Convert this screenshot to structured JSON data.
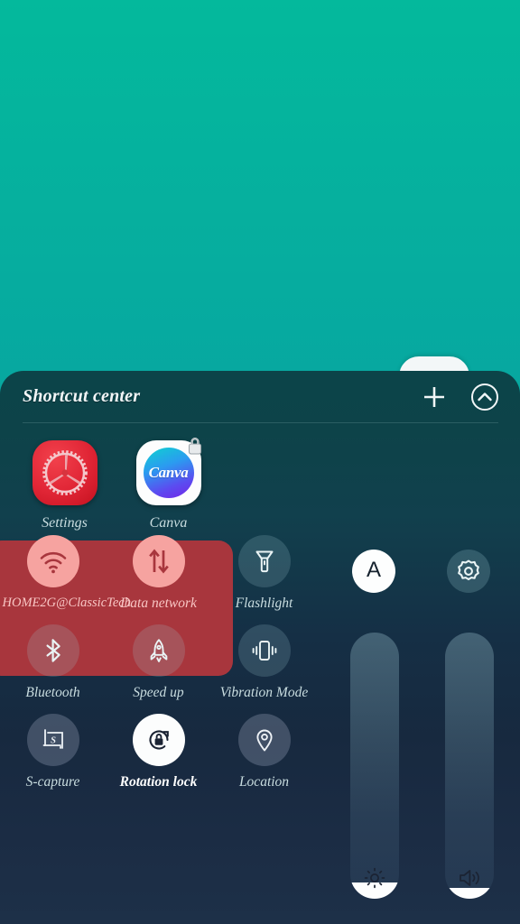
{
  "wallpaper": {
    "gradient_top": "#04b99c",
    "gradient_bottom": "#0b8fa6"
  },
  "panel": {
    "title": "Shortcut center",
    "background_top": "#0c4449",
    "background_bottom": "#1d3048",
    "header_actions": [
      {
        "name": "add-shortcut",
        "icon": "plus-icon",
        "label": "Add"
      },
      {
        "name": "collapse-panel",
        "icon": "chevron-up-circle-icon",
        "label": "Collapse"
      }
    ]
  },
  "app_shortcuts": [
    {
      "label": "Settings",
      "icon": "settings-gear-app-icon",
      "icon_color": "#e02535",
      "locked": false
    },
    {
      "label": "Canva",
      "icon": "canva-app-icon",
      "wordmark": "Canva",
      "icon_color": "#7324e8",
      "locked": true,
      "badge_icon": "lock-icon"
    }
  ],
  "highlight_group": {
    "color": "#a8363d",
    "contains": [
      "HOME2G@ClassicTech",
      "Data network"
    ]
  },
  "toggles": [
    {
      "label": "HOME2G@ClassicTech",
      "icon": "wifi-icon",
      "state": "on",
      "style": "on-red"
    },
    {
      "label": "Data network",
      "icon": "data-transfer-arrows-icon",
      "state": "on",
      "style": "on-red"
    },
    {
      "label": "Flashlight",
      "icon": "flashlight-icon",
      "state": "off",
      "style": "default"
    },
    {
      "label": "Bluetooth",
      "icon": "bluetooth-icon",
      "state": "off",
      "style": "default"
    },
    {
      "label": "Speed up",
      "icon": "rocket-icon",
      "state": "off",
      "style": "default"
    },
    {
      "label": "Vibration Mode",
      "icon": "vibration-icon",
      "state": "off",
      "style": "default"
    },
    {
      "label": "S-capture",
      "icon": "screen-capture-icon",
      "state": "off",
      "style": "grey"
    },
    {
      "label": "Rotation lock",
      "icon": "rotation-lock-icon",
      "state": "on",
      "style": "on-white"
    },
    {
      "label": "Location",
      "icon": "location-pin-icon",
      "state": "off",
      "style": "grey"
    }
  ],
  "right_controls": {
    "auto_brightness": {
      "name": "auto-brightness-toggle",
      "letter": "A",
      "state": "on"
    },
    "quick_settings": {
      "name": "quick-settings-button",
      "icon": "gear-icon",
      "state": "off"
    },
    "sliders": [
      {
        "name": "brightness-slider",
        "icon": "brightness-sun-icon",
        "value_percent": 6,
        "min": 0,
        "max": 100
      },
      {
        "name": "volume-slider",
        "icon": "volume-speaker-icon",
        "value_percent": 4,
        "min": 0,
        "max": 100
      }
    ]
  }
}
